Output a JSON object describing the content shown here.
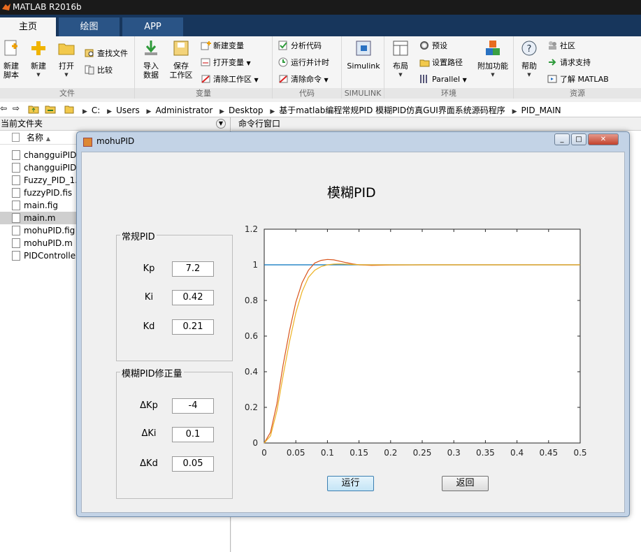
{
  "app": {
    "title": "MATLAB R2016b"
  },
  "tabs": [
    {
      "label": "主页"
    },
    {
      "label": "绘图"
    },
    {
      "label": "APP"
    }
  ],
  "ribbon": {
    "file": {
      "label": "文件",
      "new_script": "新建\n脚本",
      "new": "新建",
      "open": "打开",
      "find_files": "查找文件",
      "compare": "比较"
    },
    "variable": {
      "label": "变量",
      "import": "导入\n数据",
      "save_ws": "保存\n工作区",
      "new_var": "新建变量",
      "open_var": "打开变量",
      "clear_ws": "清除工作区"
    },
    "code": {
      "label": "代码",
      "analyze": "分析代码",
      "run_time": "运行并计时",
      "clear_cmd": "清除命令"
    },
    "simulink": {
      "label": "SIMULINK",
      "btn": "Simulink"
    },
    "env": {
      "label": "环境",
      "layout": "布局",
      "prefs": "预设",
      "set_path": "设置路径",
      "parallel": "Parallel",
      "addons": "附加功能"
    },
    "resources": {
      "label": "资源",
      "help": "帮助",
      "community": "社区",
      "support": "请求支持",
      "learn": "了解 MATLAB"
    }
  },
  "path": [
    "C:",
    "Users",
    "Administrator",
    "Desktop",
    "基于matlab编程常规PID 模糊PID仿真GUI界面系统源码程序",
    "PID_MAIN"
  ],
  "left_panel": {
    "title": "当前文件夹",
    "column": "名称",
    "files": [
      "changguiPID",
      "changguiPID",
      "Fuzzy_PID_1.",
      "fuzzyPID.fis",
      "main.fig",
      "main.m",
      "mohuPID.fig",
      "mohuPID.m",
      "PIDControlle"
    ],
    "selected_index": 5
  },
  "cmd_panel": {
    "title": "命令行窗口"
  },
  "figure": {
    "window_title": "mohuPID",
    "heading": "模糊PID",
    "group1": {
      "title": "常规PID",
      "params": [
        {
          "label": "Kp",
          "value": "7.2"
        },
        {
          "label": "Ki",
          "value": "0.42"
        },
        {
          "label": "Kd",
          "value": "0.21"
        }
      ]
    },
    "group2": {
      "title": "模糊PID修正量",
      "params": [
        {
          "label": "ΔKp",
          "value": "-4"
        },
        {
          "label": "ΔKi",
          "value": "0.1"
        },
        {
          "label": "ΔKd",
          "value": "0.05"
        }
      ]
    },
    "run_button": "运行",
    "back_button": "返回"
  },
  "chart_data": {
    "type": "line",
    "xlim": [
      0,
      0.5
    ],
    "ylim": [
      0,
      1.2
    ],
    "xticks": [
      "0",
      "0.05",
      "0.1",
      "0.15",
      "0.2",
      "0.25",
      "0.3",
      "0.35",
      "0.4",
      "0.45",
      "0.5"
    ],
    "yticks": [
      "0",
      "0.2",
      "0.4",
      "0.6",
      "0.8",
      "1",
      "1.2"
    ],
    "grid": false,
    "series": [
      {
        "color": "#0072bd",
        "x": [
          0,
          0.5
        ],
        "y": [
          1,
          1
        ]
      },
      {
        "color": "#d95319",
        "x": [
          0,
          0.01,
          0.02,
          0.03,
          0.04,
          0.05,
          0.06,
          0.07,
          0.08,
          0.09,
          0.1,
          0.11,
          0.12,
          0.13,
          0.14,
          0.15,
          0.17,
          0.2,
          0.25,
          0.3,
          0.4,
          0.5
        ],
        "y": [
          0,
          0.06,
          0.22,
          0.44,
          0.63,
          0.79,
          0.9,
          0.97,
          1.01,
          1.025,
          1.03,
          1.028,
          1.02,
          1.012,
          1.005,
          1.0,
          0.997,
          0.999,
          1.0,
          1.0,
          1.0,
          1.0
        ]
      },
      {
        "color": "#edb120",
        "x": [
          0,
          0.01,
          0.02,
          0.03,
          0.04,
          0.05,
          0.06,
          0.07,
          0.08,
          0.09,
          0.1,
          0.11,
          0.12,
          0.14,
          0.16,
          0.2,
          0.3,
          0.5
        ],
        "y": [
          0,
          0.04,
          0.18,
          0.38,
          0.57,
          0.73,
          0.85,
          0.93,
          0.97,
          0.99,
          1.0,
          1.004,
          1.005,
          1.002,
          1.0,
          1.0,
          1.0,
          1.0
        ]
      }
    ]
  }
}
